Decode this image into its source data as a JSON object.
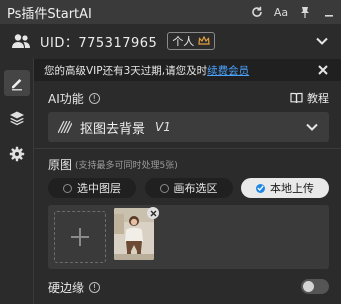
{
  "app": {
    "title": "Ps插件StartAI"
  },
  "title_controls": [
    {
      "icon": "refresh-icon"
    },
    {
      "icon": "font-size-icon",
      "label": "Aa"
    },
    {
      "icon": "pin-icon"
    },
    {
      "icon": "minimize-icon"
    }
  ],
  "account": {
    "uid_label": "UID：775317965",
    "tier_badge": "个人",
    "badge_color": "#e2a040"
  },
  "notice": {
    "message": "您的高级VIP还有3天过期,请您及时",
    "link": "续费会员",
    "link_color": "#4aa3ff"
  },
  "sidebar": {
    "items": [
      {
        "icon": "edit-icon",
        "active": true
      },
      {
        "icon": "layers-icon"
      },
      {
        "icon": "gear-icon"
      }
    ]
  },
  "ai_function": {
    "label": "AI功能",
    "info_glyph": "!",
    "tutorial_label": "教程",
    "selected_tool": "抠图去背景",
    "version_tag": "V1"
  },
  "source": {
    "label": "原图",
    "hint": "(支持最多可同时处理5张)",
    "options": [
      {
        "label": "选中图层",
        "checked": false
      },
      {
        "label": "画布选区",
        "checked": false
      },
      {
        "label": "本地上传",
        "checked": true
      }
    ]
  },
  "hard_edge": {
    "label": "硬边缘",
    "info_glyph": "!",
    "enabled": false
  },
  "accent_color": "#1e86e6"
}
